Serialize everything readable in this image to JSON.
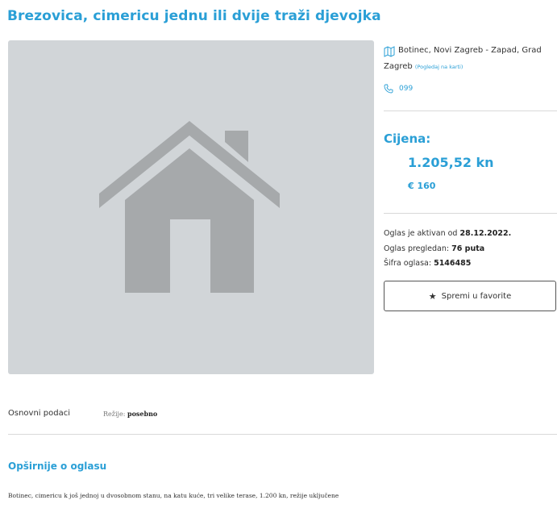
{
  "ad": {
    "title": "Brezovica, cimericu jednu ili dvije traži djevojka"
  },
  "location": {
    "text": "Botinec, Novi Zagreb - Zapad, Grad Zagreb",
    "map_link": "(Pogledaj na karti)",
    "map_icon": "map-icon"
  },
  "contact": {
    "phone": "099",
    "phone_icon": "phone-icon"
  },
  "price": {
    "label": "Cijena:",
    "kn": "1.205,52 kn",
    "eur": "€ 160"
  },
  "meta": {
    "active_label": "Oglas je aktivan od",
    "active_value": "28.12.2022.",
    "views_label": "Oglas pregledan:",
    "views_value": "76 puta",
    "code_label": "Šifra oglasa:",
    "code_value": "5146485"
  },
  "favorite": {
    "label": "Spremi u favorite",
    "icon": "star-icon"
  },
  "basic": {
    "label": "Osnovni podaci",
    "rezije_label": "Režije:",
    "rezije_value": "posebno"
  },
  "details": {
    "title": "Opširnije o oglasu",
    "text": "Botinec, cimericu k još jednoj u dvosobnom stanu, na katu kuće, tri velike terase, 1.200 kn, režije uključene"
  },
  "colors": {
    "accent": "#2a9fd6",
    "placeholder_bg": "#d1d5d8",
    "placeholder_icon": "#a6a9ab"
  }
}
